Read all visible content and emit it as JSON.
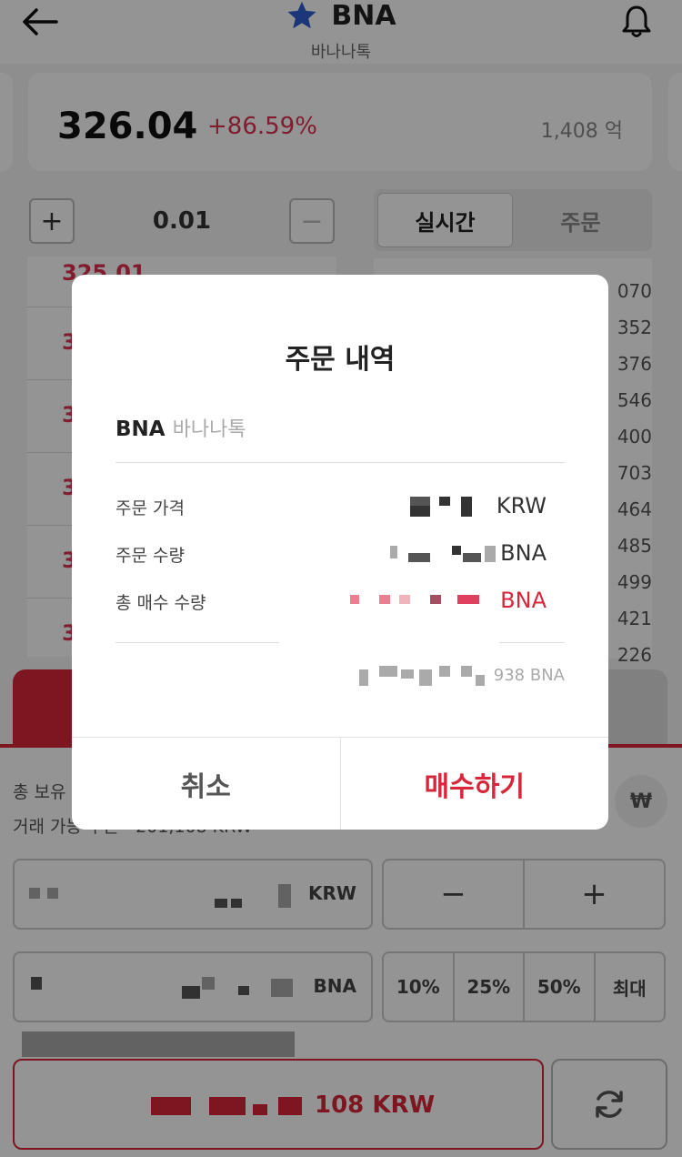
{
  "header": {
    "title": "BNA",
    "subtitle": "바나나톡"
  },
  "price_card": {
    "price": "326.04",
    "change": "+86.59%",
    "volume": "1,408 억"
  },
  "stepper": {
    "plus": "+",
    "value": "0.01",
    "minus": "−"
  },
  "tabs": [
    "실시간",
    "주문"
  ],
  "orderbook": {
    "left_first_price": "325.01",
    "left_row_prefix": "3",
    "right_values": [
      "070",
      "352",
      "376",
      "546",
      "400",
      "703",
      "464",
      "485",
      "499",
      "421",
      "226"
    ]
  },
  "buy_panel": {
    "hold_label": "총 보유",
    "avail_label": "거래 가능 수는 · 201,108 KRW",
    "won_symbol": "₩",
    "price_unit": "KRW",
    "qty_unit": "BNA",
    "minus": "−",
    "plus": "+",
    "percents": [
      "10%",
      "25%",
      "50%",
      "최대"
    ],
    "submit_suffix": "108 KRW"
  },
  "dialog": {
    "title": "주문 내역",
    "coin_symbol": "BNA",
    "coin_name": "바나나톡",
    "order_price_label": "주문 가격",
    "order_price_unit": "KRW",
    "order_qty_label": "주문 수량",
    "order_qty_unit": "BNA",
    "total_qty_label": "총 매수 수량",
    "total_qty_unit": "BNA",
    "footnote_suffix": "938 BNA",
    "cancel": "취소",
    "confirm": "매수하기"
  },
  "colors": {
    "accent": "#d8263a",
    "up": "#e03050",
    "star": "#2f5fd0"
  }
}
